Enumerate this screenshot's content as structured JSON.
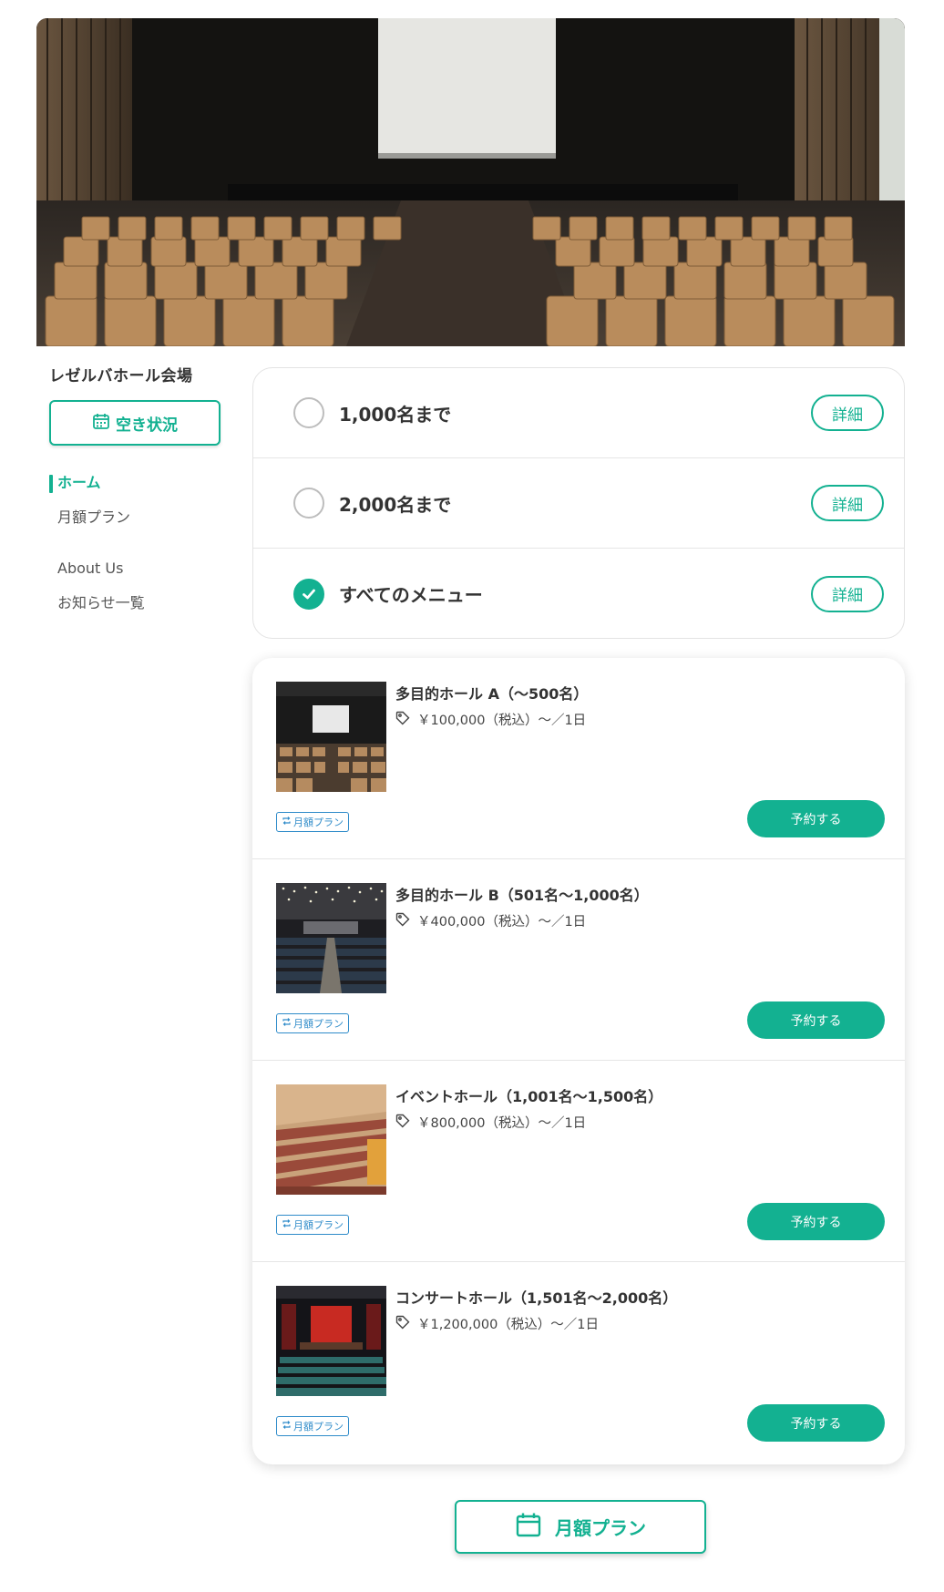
{
  "venue": {
    "name": "レゼルバホール会場"
  },
  "availability_button": {
    "label": "空き状況",
    "icon": "calendar-icon"
  },
  "nav": {
    "items": [
      {
        "label": "ホーム",
        "active": true
      },
      {
        "label": "月額プラン",
        "active": false
      },
      {
        "label": "About Us",
        "active": false
      },
      {
        "label": "お知らせ一覧",
        "active": false
      }
    ]
  },
  "filters": [
    {
      "label": "1,000名まで",
      "checked": false,
      "detail_label": "詳細"
    },
    {
      "label": "2,000名まで",
      "checked": false,
      "detail_label": "詳細"
    },
    {
      "label": "すべてのメニュー",
      "checked": true,
      "detail_label": "詳細"
    }
  ],
  "listings": [
    {
      "title": "多目的ホール A（〜500名）",
      "price": "￥100,000（税込）〜／1日",
      "badge": "月額プラン",
      "button": "予約する",
      "thumb": "screen-hall"
    },
    {
      "title": "多目的ホール B（501名〜1,000名）",
      "price": "￥400,000（税込）〜／1日",
      "badge": "月額プラン",
      "button": "予約する",
      "thumb": "dark-auditorium"
    },
    {
      "title": "イベントホール（1,001名〜1,500名）",
      "price": "￥800,000（税込）〜／1日",
      "badge": "月額プラン",
      "button": "予約する",
      "thumb": "red-seats"
    },
    {
      "title": "コンサートホール（1,501名〜2,000名）",
      "price": "￥1,200,000（税込）〜／1日",
      "badge": "月額プラン",
      "button": "予約する",
      "thumb": "red-stage"
    }
  ],
  "monthly_plan_button": {
    "label": "月額プラン",
    "icon": "calendar-icon"
  },
  "colors": {
    "accent": "#13b191",
    "badge": "#2e8bc9",
    "text": "#333333"
  }
}
